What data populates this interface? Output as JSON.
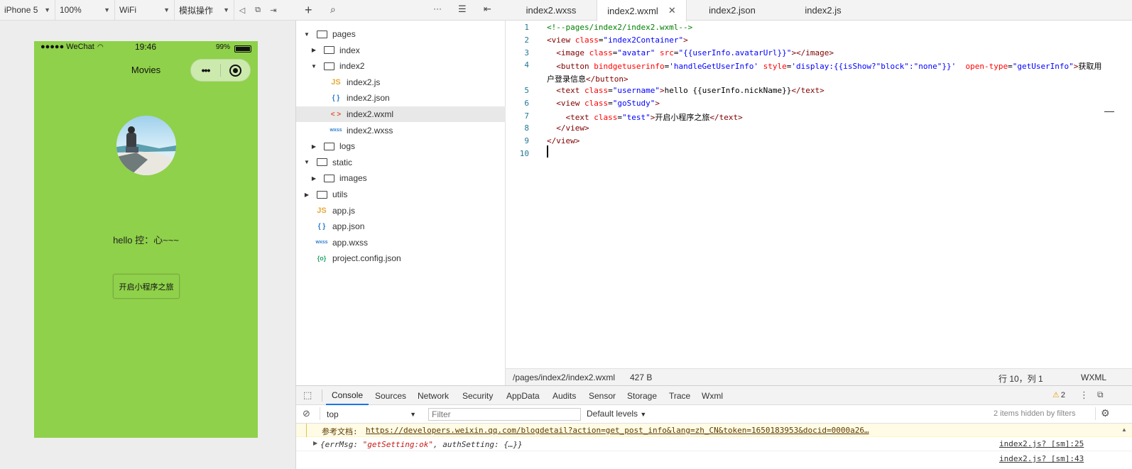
{
  "simulator": {
    "device": "iPhone 5",
    "zoom": "100%",
    "network": "WiFi",
    "operation": "模拟操作",
    "phone": {
      "carrier": "●●●●● WeChat",
      "time": "19:46",
      "battery": "99%",
      "nav_title": "Movies",
      "username": "hello 控：心~~~",
      "button_label": "开启小程序之旅",
      "bg_color": "#8fd14a"
    }
  },
  "explorer": {
    "items": [
      {
        "label": "pages",
        "type": "folder",
        "expanded": true,
        "depth": 0
      },
      {
        "label": "index",
        "type": "folder",
        "expanded": false,
        "depth": 1
      },
      {
        "label": "index2",
        "type": "folder",
        "expanded": true,
        "depth": 1
      },
      {
        "label": "index2.js",
        "type": "js",
        "depth": 2
      },
      {
        "label": "index2.json",
        "type": "json",
        "depth": 2
      },
      {
        "label": "index2.wxml",
        "type": "wxml",
        "depth": 2,
        "active": true
      },
      {
        "label": "index2.wxss",
        "type": "wxss",
        "depth": 2
      },
      {
        "label": "logs",
        "type": "folder",
        "expanded": false,
        "depth": 1
      },
      {
        "label": "static",
        "type": "folder",
        "expanded": true,
        "depth": 0
      },
      {
        "label": "images",
        "type": "folder",
        "expanded": false,
        "depth": 1
      },
      {
        "label": "utils",
        "type": "folder",
        "expanded": false,
        "depth": 0
      },
      {
        "label": "app.js",
        "type": "js",
        "depth": 0
      },
      {
        "label": "app.json",
        "type": "json",
        "depth": 0
      },
      {
        "label": "app.wxss",
        "type": "wxss",
        "depth": 0
      },
      {
        "label": "project.config.json",
        "type": "config",
        "depth": 0
      }
    ]
  },
  "editor": {
    "tabs": [
      {
        "label": "index2.wxss",
        "active": false
      },
      {
        "label": "index2.wxml",
        "active": true
      },
      {
        "label": "index2.json",
        "active": false
      },
      {
        "label": "index2.js",
        "active": false
      }
    ],
    "lines": [
      {
        "n": "1",
        "text": "<!--pages/index2/index2.wxml-->"
      },
      {
        "n": "2",
        "text": "<view class=\"index2Container\">"
      },
      {
        "n": "3",
        "text": "  <image class=\"avatar\" src=\"{{userInfo.avatarUrl}}\"></image>"
      },
      {
        "n": "4",
        "text": "  <button bindgetuserinfo='handleGetUserInfo' style='display:{{isShow?\"block\":\"none\"}}'  open-type=\"getUserInfo\">获取用"
      },
      {
        "n": "",
        "text": "户登录信息</button>"
      },
      {
        "n": "5",
        "text": "  <text class=\"username\">hello {{userInfo.nickName}}</text>"
      },
      {
        "n": "6",
        "text": "  <view class=\"goStudy\">"
      },
      {
        "n": "7",
        "text": "    <text class=\"test\">开启小程序之旅</text>"
      },
      {
        "n": "8",
        "text": "  </view>"
      },
      {
        "n": "9",
        "text": "</view>"
      },
      {
        "n": "10",
        "text": ""
      }
    ],
    "status": {
      "path": "/pages/index2/index2.wxml",
      "size": "427 B",
      "position": "行 10，列 1",
      "language": "WXML"
    }
  },
  "devtools": {
    "tabs": [
      "Console",
      "Sources",
      "Network",
      "Security",
      "AppData",
      "Audits",
      "Sensor",
      "Storage",
      "Trace",
      "Wxml"
    ],
    "active_tab": "Console",
    "warning_count": "2",
    "context": "top",
    "filter_placeholder": "Filter",
    "levels": "Default levels",
    "hidden_note": "2 items hidden by filters",
    "logs": {
      "doc_label": "参考文档:",
      "doc_url": "https://developers.weixin.qq.com/blogdetail?action=get_post_info&lang=zh_CN&token=1650183953&docid=0000a26…",
      "obj_prefix": "{errMsg: ",
      "obj_str": "\"getSetting:ok\"",
      "obj_suffix": ", authSetting: {…}}",
      "src1": "index2.js? [sm]:25",
      "src2": "index2.js? [sm]:43"
    }
  }
}
